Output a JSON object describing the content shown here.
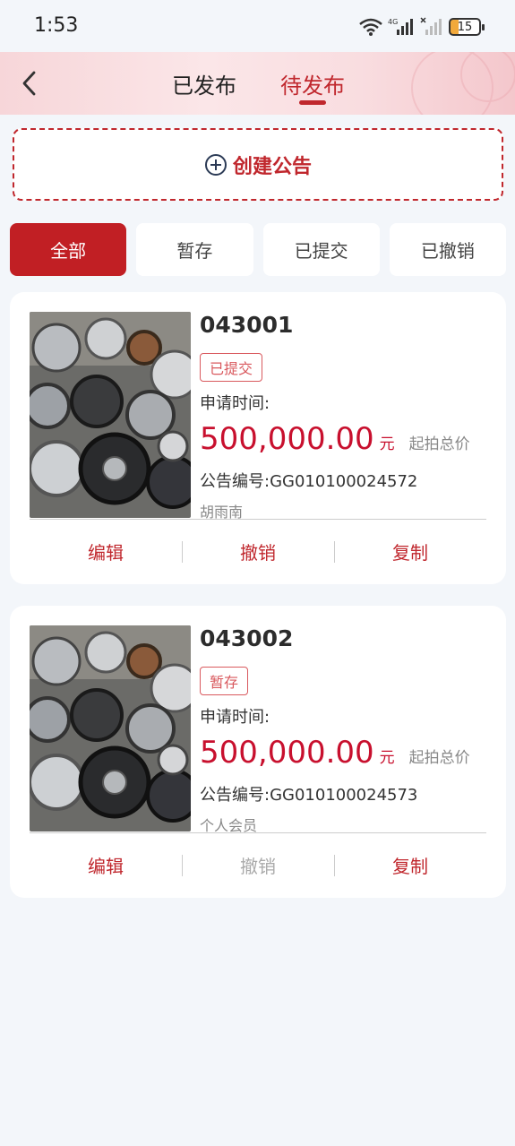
{
  "status_bar": {
    "time": "1:53",
    "battery": "15",
    "signal_label": "4G"
  },
  "header": {
    "tabs": [
      {
        "label": "已发布",
        "active": false
      },
      {
        "label": "待发布",
        "active": true
      }
    ]
  },
  "create": {
    "label": "创建公告"
  },
  "filters": [
    {
      "label": "全部",
      "active": true
    },
    {
      "label": "暂存",
      "active": false
    },
    {
      "label": "已提交",
      "active": false
    },
    {
      "label": "已撤销",
      "active": false
    }
  ],
  "cards": [
    {
      "id": "043001",
      "status": "已提交",
      "apply_time_label": "申请时间:",
      "price": "500,000.00",
      "currency": "元",
      "price_label": "起拍总价",
      "announcement_no": "公告编号:GG010100024572",
      "publisher": "胡雨南",
      "actions": [
        {
          "label": "编辑",
          "enabled": true
        },
        {
          "label": "撤销",
          "enabled": true
        },
        {
          "label": "复制",
          "enabled": true
        }
      ]
    },
    {
      "id": "043002",
      "status": "暂存",
      "apply_time_label": "申请时间:",
      "price": "500,000.00",
      "currency": "元",
      "price_label": "起拍总价",
      "announcement_no": "公告编号:GG010100024573",
      "publisher": "个人会员",
      "actions": [
        {
          "label": "编辑",
          "enabled": true
        },
        {
          "label": "撤销",
          "enabled": false
        },
        {
          "label": "复制",
          "enabled": true
        }
      ]
    }
  ],
  "colors": {
    "accent": "#c0272d",
    "price": "#c8102e",
    "background": "#f3f6fa"
  }
}
